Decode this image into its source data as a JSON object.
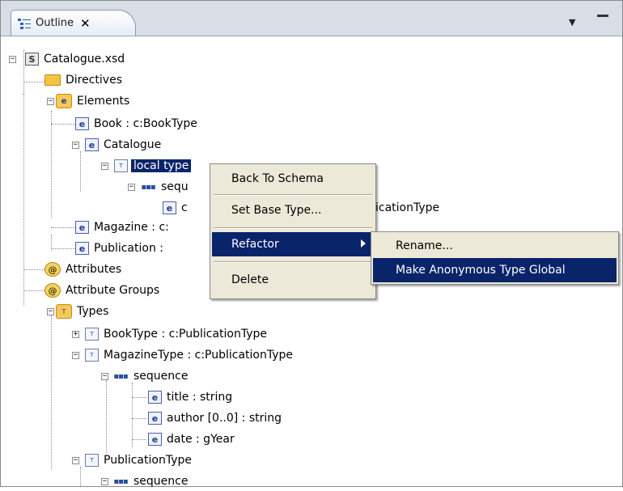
{
  "view": {
    "tab_label": "Outline",
    "close_glyph": "✕",
    "menu_glyph": "▼"
  },
  "tree": {
    "catalogue_xsd": "Catalogue.xsd",
    "directives": "Directives",
    "elements": "Elements",
    "book": "Book : c:BookType",
    "catalogue": "Catalogue",
    "local_type": "local type",
    "sequence_1": "sequ",
    "child_element": "c",
    "child_element_tail": "icationType",
    "magazine": "Magazine : c:",
    "publication": "Publication : ",
    "attributes": "Attributes",
    "attribute_groups": "Attribute Groups",
    "types": "Types",
    "booktype": "BookType : c:PublicationType",
    "magazinetype": "MagazineType : c:PublicationType",
    "sequence_2": "sequence",
    "title": "title : string",
    "author": "author [0..0] : string",
    "date": "date : gYear",
    "publicationtype": "PublicationType",
    "sequence_3": "sequence"
  },
  "icons": {
    "schema": "S",
    "element": "e",
    "attribute": "@",
    "attribute_group": "@",
    "type": "T",
    "sequence": "▪▪▪"
  },
  "context_menu": {
    "back_to_schema": "Back To Schema",
    "set_base_type": "Set Base Type...",
    "refactor": "Refactor",
    "delete": "Delete"
  },
  "submenu": {
    "rename": "Rename...",
    "make_anonymous_global": "Make Anonymous Type Global"
  },
  "colors": {
    "selection": "#0a246a",
    "menu_bg": "#ece9d8",
    "tabbar_bg": "#d8dde6"
  }
}
